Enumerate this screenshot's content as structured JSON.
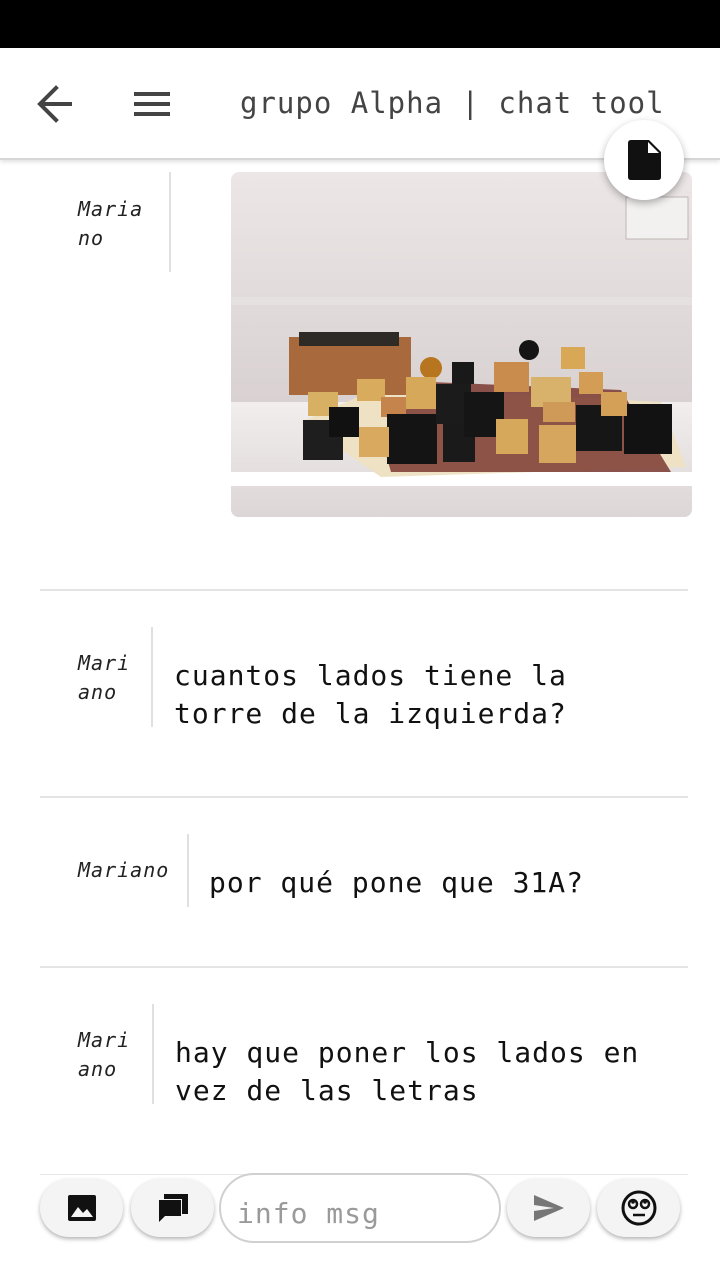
{
  "header": {
    "title": "grupo Alpha | chat tool"
  },
  "messages": [
    {
      "author": "Maria no",
      "type": "image",
      "image_alt": "photo"
    },
    {
      "author": "Mari ano",
      "text": "cuantos lados tiene la torre de la izquierda?"
    },
    {
      "author": "Mariano",
      "text": "por qué pone que 31A?"
    },
    {
      "author": "Mari ano",
      "text": "hay que poner los lados en vez de las letras"
    }
  ],
  "composer": {
    "placeholder": "info msg"
  },
  "icons": {
    "back": "arrow-back-icon",
    "menu": "menu-icon",
    "document": "document-icon",
    "image": "image-icon",
    "chat": "chat-icon",
    "send": "send-icon",
    "emoji": "emoji-icon"
  },
  "colors": {
    "status_bar": "#000000",
    "icon": "#444444",
    "divider": "#e4e4e4"
  }
}
